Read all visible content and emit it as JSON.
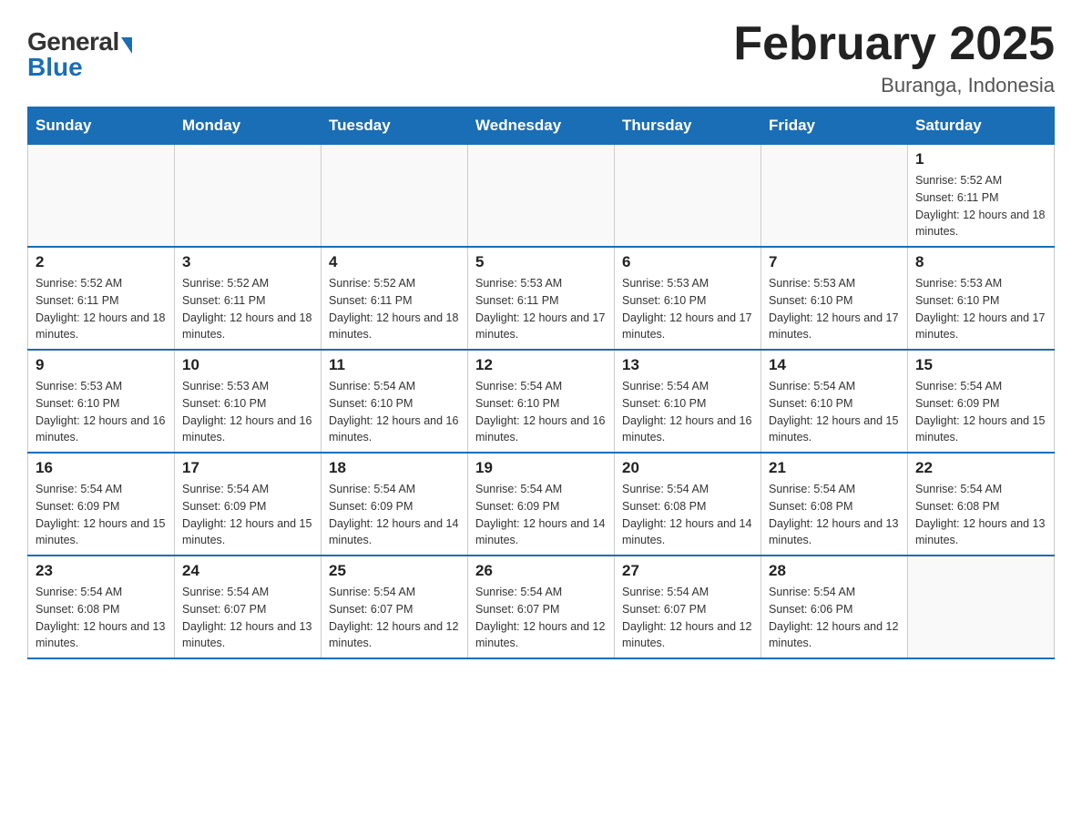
{
  "header": {
    "logo_general": "General",
    "logo_blue": "Blue",
    "month_title": "February 2025",
    "location": "Buranga, Indonesia"
  },
  "weekdays": [
    "Sunday",
    "Monday",
    "Tuesday",
    "Wednesday",
    "Thursday",
    "Friday",
    "Saturday"
  ],
  "weeks": [
    [
      {
        "day": "",
        "info": ""
      },
      {
        "day": "",
        "info": ""
      },
      {
        "day": "",
        "info": ""
      },
      {
        "day": "",
        "info": ""
      },
      {
        "day": "",
        "info": ""
      },
      {
        "day": "",
        "info": ""
      },
      {
        "day": "1",
        "info": "Sunrise: 5:52 AM\nSunset: 6:11 PM\nDaylight: 12 hours and 18 minutes."
      }
    ],
    [
      {
        "day": "2",
        "info": "Sunrise: 5:52 AM\nSunset: 6:11 PM\nDaylight: 12 hours and 18 minutes."
      },
      {
        "day": "3",
        "info": "Sunrise: 5:52 AM\nSunset: 6:11 PM\nDaylight: 12 hours and 18 minutes."
      },
      {
        "day": "4",
        "info": "Sunrise: 5:52 AM\nSunset: 6:11 PM\nDaylight: 12 hours and 18 minutes."
      },
      {
        "day": "5",
        "info": "Sunrise: 5:53 AM\nSunset: 6:11 PM\nDaylight: 12 hours and 17 minutes."
      },
      {
        "day": "6",
        "info": "Sunrise: 5:53 AM\nSunset: 6:10 PM\nDaylight: 12 hours and 17 minutes."
      },
      {
        "day": "7",
        "info": "Sunrise: 5:53 AM\nSunset: 6:10 PM\nDaylight: 12 hours and 17 minutes."
      },
      {
        "day": "8",
        "info": "Sunrise: 5:53 AM\nSunset: 6:10 PM\nDaylight: 12 hours and 17 minutes."
      }
    ],
    [
      {
        "day": "9",
        "info": "Sunrise: 5:53 AM\nSunset: 6:10 PM\nDaylight: 12 hours and 16 minutes."
      },
      {
        "day": "10",
        "info": "Sunrise: 5:53 AM\nSunset: 6:10 PM\nDaylight: 12 hours and 16 minutes."
      },
      {
        "day": "11",
        "info": "Sunrise: 5:54 AM\nSunset: 6:10 PM\nDaylight: 12 hours and 16 minutes."
      },
      {
        "day": "12",
        "info": "Sunrise: 5:54 AM\nSunset: 6:10 PM\nDaylight: 12 hours and 16 minutes."
      },
      {
        "day": "13",
        "info": "Sunrise: 5:54 AM\nSunset: 6:10 PM\nDaylight: 12 hours and 16 minutes."
      },
      {
        "day": "14",
        "info": "Sunrise: 5:54 AM\nSunset: 6:10 PM\nDaylight: 12 hours and 15 minutes."
      },
      {
        "day": "15",
        "info": "Sunrise: 5:54 AM\nSunset: 6:09 PM\nDaylight: 12 hours and 15 minutes."
      }
    ],
    [
      {
        "day": "16",
        "info": "Sunrise: 5:54 AM\nSunset: 6:09 PM\nDaylight: 12 hours and 15 minutes."
      },
      {
        "day": "17",
        "info": "Sunrise: 5:54 AM\nSunset: 6:09 PM\nDaylight: 12 hours and 15 minutes."
      },
      {
        "day": "18",
        "info": "Sunrise: 5:54 AM\nSunset: 6:09 PM\nDaylight: 12 hours and 14 minutes."
      },
      {
        "day": "19",
        "info": "Sunrise: 5:54 AM\nSunset: 6:09 PM\nDaylight: 12 hours and 14 minutes."
      },
      {
        "day": "20",
        "info": "Sunrise: 5:54 AM\nSunset: 6:08 PM\nDaylight: 12 hours and 14 minutes."
      },
      {
        "day": "21",
        "info": "Sunrise: 5:54 AM\nSunset: 6:08 PM\nDaylight: 12 hours and 13 minutes."
      },
      {
        "day": "22",
        "info": "Sunrise: 5:54 AM\nSunset: 6:08 PM\nDaylight: 12 hours and 13 minutes."
      }
    ],
    [
      {
        "day": "23",
        "info": "Sunrise: 5:54 AM\nSunset: 6:08 PM\nDaylight: 12 hours and 13 minutes."
      },
      {
        "day": "24",
        "info": "Sunrise: 5:54 AM\nSunset: 6:07 PM\nDaylight: 12 hours and 13 minutes."
      },
      {
        "day": "25",
        "info": "Sunrise: 5:54 AM\nSunset: 6:07 PM\nDaylight: 12 hours and 12 minutes."
      },
      {
        "day": "26",
        "info": "Sunrise: 5:54 AM\nSunset: 6:07 PM\nDaylight: 12 hours and 12 minutes."
      },
      {
        "day": "27",
        "info": "Sunrise: 5:54 AM\nSunset: 6:07 PM\nDaylight: 12 hours and 12 minutes."
      },
      {
        "day": "28",
        "info": "Sunrise: 5:54 AM\nSunset: 6:06 PM\nDaylight: 12 hours and 12 minutes."
      },
      {
        "day": "",
        "info": ""
      }
    ]
  ]
}
